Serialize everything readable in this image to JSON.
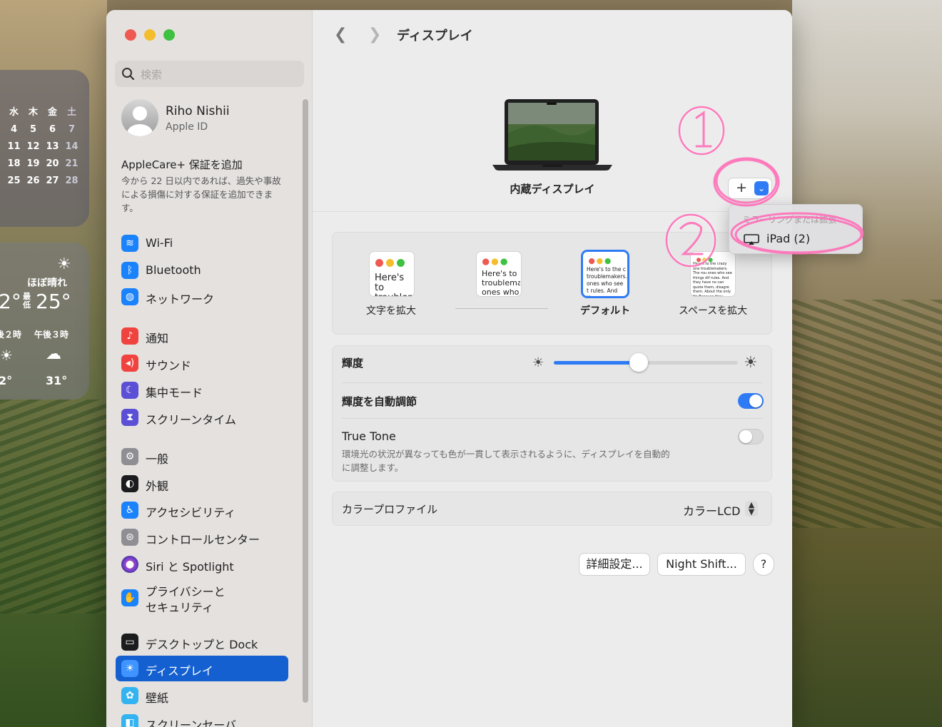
{
  "desktop": {
    "calendar": {
      "weekdays": [
        "水",
        "木",
        "金",
        "土"
      ],
      "weeks": [
        [
          "4",
          "5",
          "6",
          "7"
        ],
        [
          "11",
          "12",
          "13",
          "14"
        ],
        [
          "18",
          "19",
          "20",
          "21"
        ],
        [
          "25",
          "26",
          "27",
          "28"
        ]
      ]
    },
    "weather": {
      "condition": "ほぼ晴れ",
      "temp_left": "2°",
      "low_label": "最低",
      "temp_low": "25°",
      "hour1": "後２時",
      "hour2": "午後３時",
      "hour1_temp": "2°",
      "hour2_temp": "31°"
    }
  },
  "sidebar": {
    "search_placeholder": "検索",
    "profile": {
      "name": "Riho Nishii",
      "subtitle": "Apple ID"
    },
    "applecare": {
      "title": "AppleCare+ 保証を追加",
      "body": "今から 22 日以内であれば、過失や事故による損傷に対する保証を追加できます。"
    },
    "items": [
      {
        "label": "Wi-Fi",
        "icon": "wifi-icon",
        "color": "#1a82fb"
      },
      {
        "label": "Bluetooth",
        "icon": "bluetooth-icon",
        "color": "#1a82fb"
      },
      {
        "label": "ネットワーク",
        "icon": "globe-icon",
        "color": "#1a82fb"
      },
      {
        "label": "通知",
        "icon": "bell-icon",
        "color": "#f0433f"
      },
      {
        "label": "サウンド",
        "icon": "speaker-icon",
        "color": "#f0433f"
      },
      {
        "label": "集中モード",
        "icon": "moon-icon",
        "color": "#5b4fd6"
      },
      {
        "label": "スクリーンタイム",
        "icon": "hourglass-icon",
        "color": "#5b4fd6"
      },
      {
        "label": "一般",
        "icon": "gear-icon",
        "color": "#8e8e93"
      },
      {
        "label": "外観",
        "icon": "appearance-icon",
        "color": "#1c1c1e"
      },
      {
        "label": "アクセシビリティ",
        "icon": "accessibility-icon",
        "color": "#1a82fb"
      },
      {
        "label": "コントロールセンター",
        "icon": "toggles-icon",
        "color": "#8e8e93"
      },
      {
        "label": "Siri と Spotlight",
        "icon": "siri-icon",
        "color": "#6b3fd1"
      },
      {
        "label": "プライバシーと",
        "label2": "セキュリティ",
        "icon": "hand-icon",
        "color": "#1a82fb"
      },
      {
        "label": "デスクトップと Dock",
        "icon": "dock-icon",
        "color": "#1c1c1e"
      },
      {
        "label": "ディスプレイ",
        "icon": "sun-icon",
        "color": "#1a82fb"
      },
      {
        "label": "壁紙",
        "icon": "flower-icon",
        "color": "#33b3f0"
      },
      {
        "label": "スクリーンセーバ",
        "icon": "screensaver-icon",
        "color": "#33b3f0"
      }
    ]
  },
  "content": {
    "title": "ディスプレイ",
    "display_name": "内蔵ディスプレイ",
    "popup": {
      "header": "ミラーリングまたは拡張",
      "item": "iPad (2)"
    },
    "resolutions": [
      {
        "label": "文字を拡大",
        "preview": "Here's to troublem",
        "selected": false
      },
      {
        "label": "",
        "preview": "Here's to troublema ones who",
        "selected": false
      },
      {
        "label": "デフォルト",
        "preview": "Here's to the c troublemakers. ones who see t rules. And they",
        "selected": true
      },
      {
        "label": "スペースを拡大",
        "preview": "Here's to the crazy one troublemakers. The rou ones who see things dif rules. And they have no can quote them, disagre them. About the only thi Because they change t",
        "selected": false
      }
    ],
    "brightness": {
      "label": "輝度",
      "value": 0.46
    },
    "auto_brightness": {
      "label": "輝度を自動調節",
      "on": true
    },
    "true_tone": {
      "label": "True Tone",
      "description_line1": "環境光の状況が異なっても色が一貫して表示されるように、ディスプレイを自動的",
      "description_line2": "に調整します。",
      "on": false
    },
    "color_profile": {
      "label": "カラープロファイル",
      "value": "カラーLCD"
    },
    "buttons": {
      "advanced": "詳細設定...",
      "night_shift": "Night Shift...",
      "help": "?"
    }
  },
  "annotations": {
    "step1": "①",
    "step2": "②"
  },
  "colors": {
    "accent": "#2f7bf6",
    "sidebar_selected": "#1460d0",
    "annotation": "#ff6fb8"
  }
}
